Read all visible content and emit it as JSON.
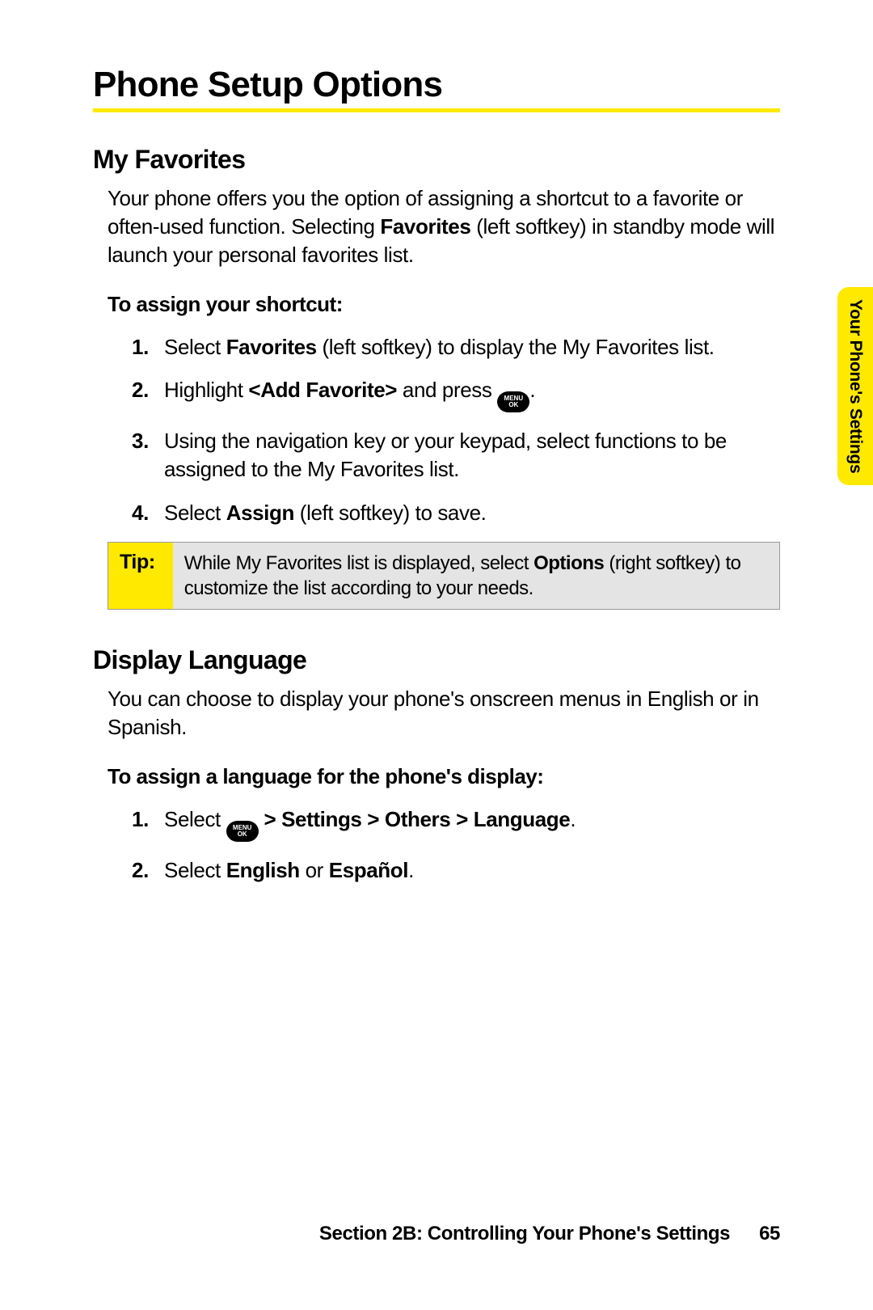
{
  "title": "Phone Setup Options",
  "side_tab": "Your Phone's Settings",
  "sections": {
    "favorites": {
      "heading": "My Favorites",
      "intro_pre": "Your phone offers you the option of assigning a shortcut to a favorite or often-used function. Selecting ",
      "intro_bold": "Favorites",
      "intro_post": " (left softkey) in standby mode will launch your personal favorites list.",
      "sub": "To assign your shortcut:",
      "steps": {
        "s1_pre": "Select ",
        "s1_bold": "Favorites",
        "s1_post": " (left softkey) to display the My Favorites list.",
        "s2_pre": "Highlight ",
        "s2_bold": "<Add Favorite>",
        "s2_mid": " and press ",
        "s2_post": ".",
        "s3": "Using the navigation key or your keypad, select functions to be assigned to the My Favorites list.",
        "s4_pre": "Select ",
        "s4_bold": "Assign",
        "s4_post": " (left softkey) to save."
      },
      "tip_label": "Tip:",
      "tip_pre": "While My Favorites list is displayed, select ",
      "tip_bold": "Options",
      "tip_post": " (right softkey) to customize the list according to your needs."
    },
    "language": {
      "heading": "Display Language",
      "intro": "You can choose to display your phone's onscreen menus in English or in Spanish.",
      "sub": "To assign a language for the phone's display:",
      "steps": {
        "s1_pre": "Select ",
        "s1_bold": " > Settings > Others > Language",
        "s1_post": ".",
        "s2_pre": "Select ",
        "s2_bold1": "English",
        "s2_mid": " or ",
        "s2_bold2": "Español",
        "s2_post": "."
      }
    }
  },
  "footer": {
    "section": "Section 2B: Controlling Your Phone's Settings",
    "page": "65"
  },
  "icons": {
    "menu_top": "MENU",
    "menu_bottom": "OK"
  }
}
